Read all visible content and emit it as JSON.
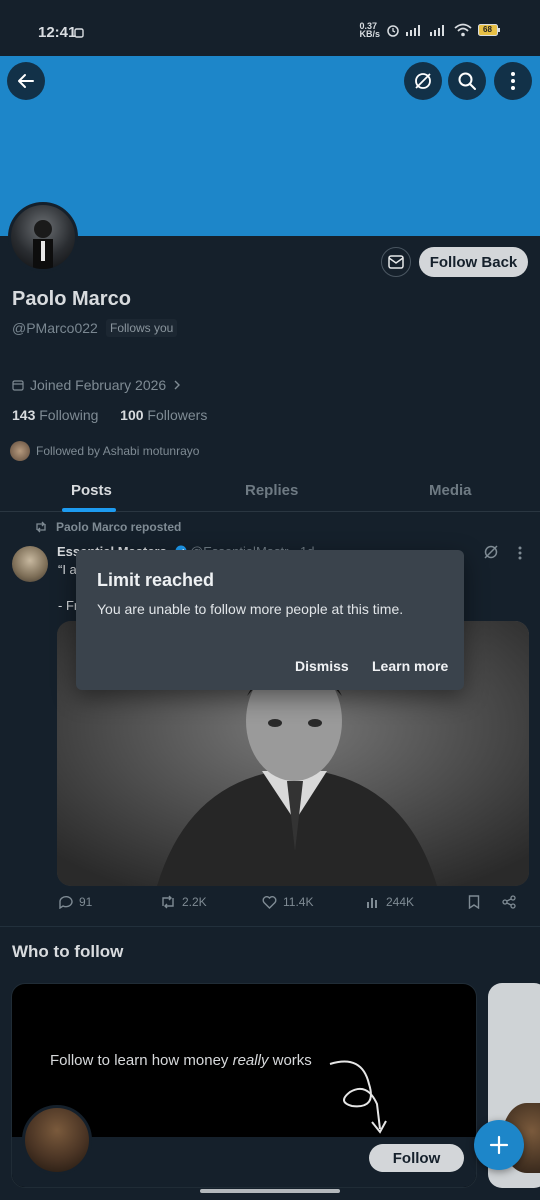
{
  "status_bar": {
    "time": "12:41",
    "speed": "0.37\nKB/s",
    "battery": "68"
  },
  "profile": {
    "name": "Paolo Marco",
    "handle": "@PMarco022",
    "follows_you_badge": "Follows you",
    "joined": "Joined February 2026",
    "following_count": "143",
    "following_label": "Following",
    "followers_count": "100",
    "followers_label": "Followers",
    "followed_by": "Followed by Ashabi motunrayo",
    "follow_back_label": "Follow Back"
  },
  "tabs": [
    {
      "label": "Posts"
    },
    {
      "label": "Replies"
    },
    {
      "label": "Media"
    }
  ],
  "post": {
    "repost_label": "Paolo Marco reposted",
    "author": "Essential Masters",
    "author_handle": "@EssentialMastr",
    "time": "· 1d",
    "text_line1": "“I a",
    "text_line2": "- Fr",
    "replies": "91",
    "reposts": "2.2K",
    "likes": "11.4K",
    "views": "244K"
  },
  "who_to_follow": {
    "title": "Who to follow",
    "card_text_prefix": "Follow to learn how money ",
    "card_text_emphasis": "really",
    "card_text_suffix": " works",
    "follow_label": "Follow"
  },
  "dialog": {
    "title": "Limit reached",
    "message": "You are unable to follow more people at this time.",
    "dismiss_label": "Dismiss",
    "learn_more_label": "Learn more"
  },
  "colors": {
    "background": "#15202b",
    "banner": "#1d86c9",
    "accent": "#1d9bf0",
    "dialog": "#3a434c"
  }
}
